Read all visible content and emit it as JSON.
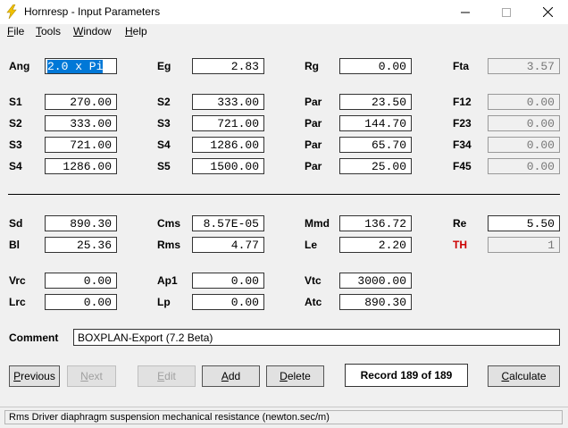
{
  "window": {
    "title": "Hornresp - Input Parameters",
    "min": "—",
    "max": "☐",
    "close": "✕"
  },
  "menu": [
    "File",
    "Tools",
    "Window",
    "Help"
  ],
  "menu_underline": [
    "F",
    "T",
    "W",
    "H"
  ],
  "menu_rest": [
    "ile",
    "ools",
    "indow",
    "elp"
  ],
  "params": {
    "ang": {
      "label": "Ang",
      "value": "2.0 x Pi"
    },
    "eg": {
      "label": "Eg",
      "value": "2.83"
    },
    "rg": {
      "label": "Rg",
      "value": "0.00"
    },
    "fta": {
      "label": "Fta",
      "value": "3.57"
    },
    "s1": {
      "label": "S1",
      "value": "270.00"
    },
    "s2a": {
      "label": "S2",
      "value": "333.00"
    },
    "par1": {
      "label": "Par",
      "value": "23.50"
    },
    "f12": {
      "label": "F12",
      "value": "0.00"
    },
    "s2b": {
      "label": "S2",
      "value": "333.00"
    },
    "s3a": {
      "label": "S3",
      "value": "721.00"
    },
    "par2": {
      "label": "Par",
      "value": "144.70"
    },
    "f23": {
      "label": "F23",
      "value": "0.00"
    },
    "s3b": {
      "label": "S3",
      "value": "721.00"
    },
    "s4a": {
      "label": "S4",
      "value": "1286.00"
    },
    "par3": {
      "label": "Par",
      "value": "65.70"
    },
    "f34": {
      "label": "F34",
      "value": "0.00"
    },
    "s4b": {
      "label": "S4",
      "value": "1286.00"
    },
    "s5": {
      "label": "S5",
      "value": "1500.00"
    },
    "par4": {
      "label": "Par",
      "value": "25.00"
    },
    "f45": {
      "label": "F45",
      "value": "0.00"
    },
    "sd": {
      "label": "Sd",
      "value": "890.30"
    },
    "cms": {
      "label": "Cms",
      "value": "8.57E-05"
    },
    "mmd": {
      "label": "Mmd",
      "value": "136.72"
    },
    "re": {
      "label": "Re",
      "value": "5.50"
    },
    "bl": {
      "label": "Bl",
      "value": "25.36"
    },
    "rms": {
      "label": "Rms",
      "value": "4.77"
    },
    "le": {
      "label": "Le",
      "value": "2.20"
    },
    "th": {
      "label": "TH",
      "value": "1"
    },
    "vrc": {
      "label": "Vrc",
      "value": "0.00"
    },
    "ap1": {
      "label": "Ap1",
      "value": "0.00"
    },
    "vtc": {
      "label": "Vtc",
      "value": "3000.00"
    },
    "lrc": {
      "label": "Lrc",
      "value": "0.00"
    },
    "lp": {
      "label": "Lp",
      "value": "0.00"
    },
    "atc": {
      "label": "Atc",
      "value": "890.30"
    }
  },
  "comment": {
    "label": "Comment",
    "value": "BOXPLAN-Export (7.2 Beta)"
  },
  "buttons": {
    "previous": {
      "u": "P",
      "rest": "revious"
    },
    "next": {
      "u": "N",
      "rest": "ext"
    },
    "edit": {
      "u": "E",
      "rest": "dit"
    },
    "add": {
      "u": "A",
      "rest": "dd"
    },
    "delete": {
      "u": "D",
      "rest": "elete"
    },
    "calculate": {
      "u": "C",
      "rest": "alculate"
    }
  },
  "record": "Record 189 of 189",
  "status": "Rms   Driver diaphragm suspension mechanical resistance  (newton.sec/m)",
  "colors": {
    "accent": "#0078d7",
    "th_label": "#cc0000",
    "app_icon": "#f2c200"
  }
}
